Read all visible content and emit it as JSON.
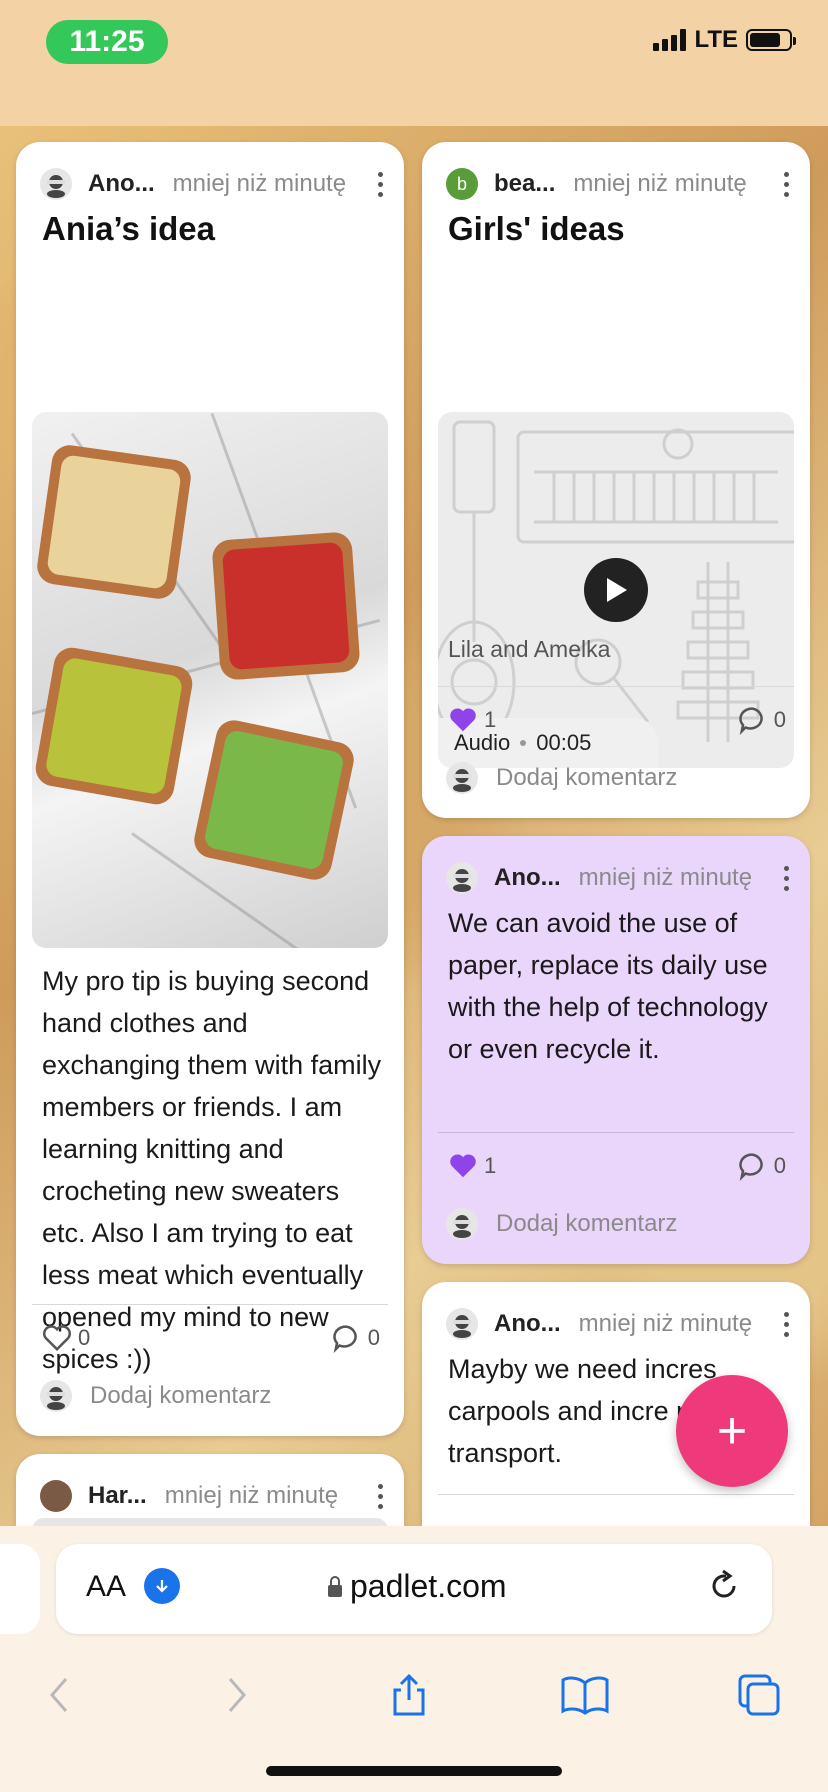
{
  "status_bar": {
    "time": "11:25",
    "network": "LTE"
  },
  "posts": [
    {
      "author": "Ano...",
      "timestamp": "mniej niż minutę",
      "title": "Ania’s idea",
      "body": "My pro tip is buying second hand clothes and exchanging them with family members or friends. I am learning knitting and crocheting new sweaters etc. Also I am trying to eat less meat which eventually opened my mind to new spices :))",
      "likes": "0",
      "comments": "0",
      "comment_placeholder": "Dodaj komentarz"
    },
    {
      "author": "Har...",
      "timestamp": "mniej niż minutę"
    },
    {
      "author": "bea...",
      "avatar_letter": "b",
      "timestamp": "mniej niż minutę",
      "title": "Girls' ideas",
      "audio_label": "Audio",
      "audio_duration": "00:05",
      "caption": "Lila and Amelka",
      "likes": "1",
      "comments": "0",
      "comment_placeholder": "Dodaj komentarz"
    },
    {
      "author": "Ano...",
      "timestamp": "mniej niż minutę",
      "body": "We can avoid the use of paper, replace its daily use with the help of technology or even recycle it.",
      "likes": "1",
      "comments": "0",
      "comment_placeholder": "Dodaj komentarz"
    },
    {
      "author": "Ano...",
      "timestamp": "mniej niż minutę",
      "body": "Mayby we need incres carpools and incre public transport."
    }
  ],
  "fab": {
    "label": "+"
  },
  "browser": {
    "text_size_label": "AA",
    "url": "padlet.com"
  },
  "colors": {
    "accent": "#ee3a7a",
    "like": "#8e44e8",
    "card_purple": "#ead5fb"
  }
}
